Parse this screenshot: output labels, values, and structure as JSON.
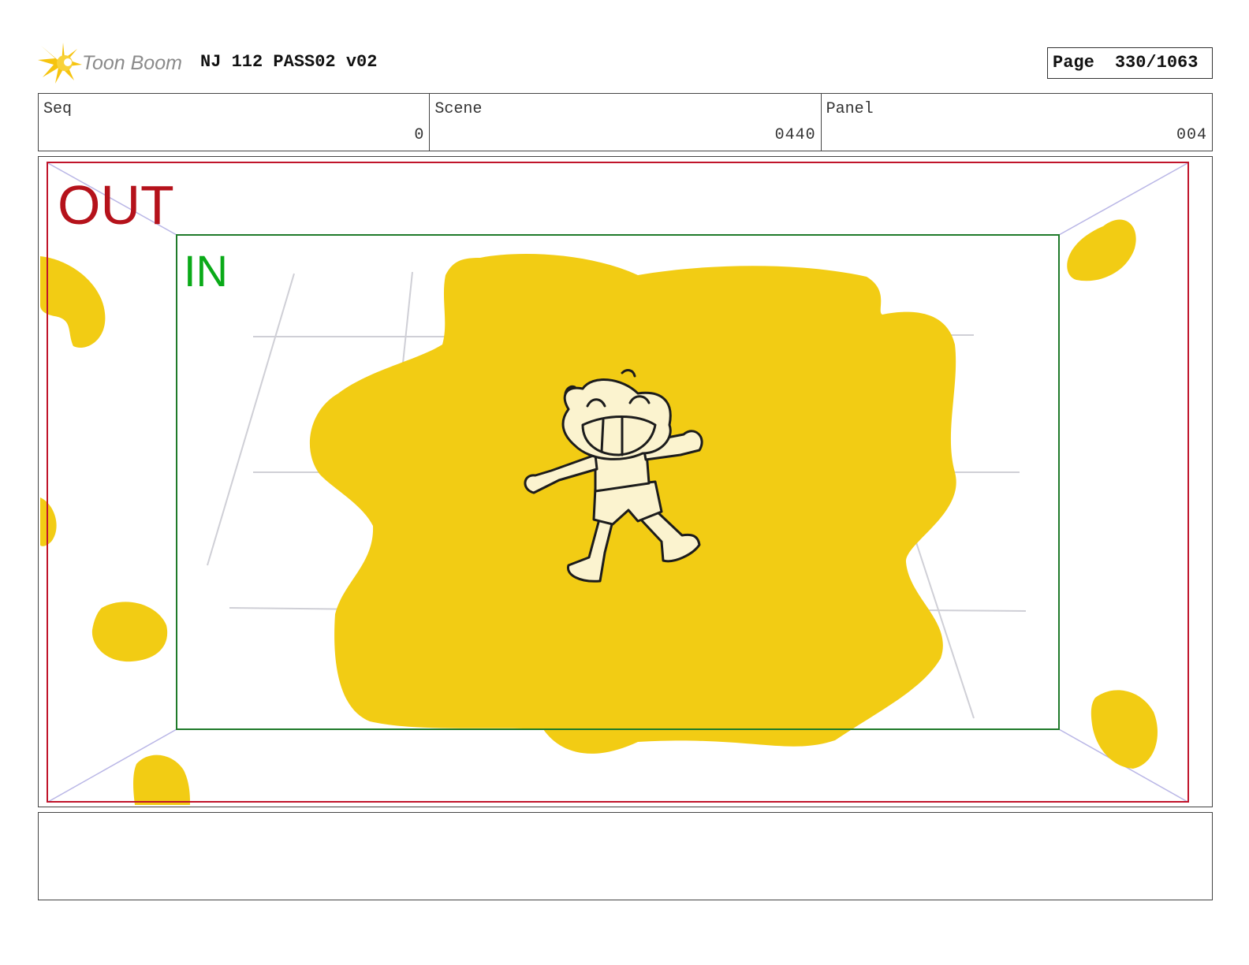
{
  "header": {
    "logo_text": "Toon Boom",
    "title": "NJ 112 PASS02 v02",
    "page_label": "Page",
    "page_value": "330/1063"
  },
  "info": {
    "seq_label": "Seq",
    "seq_value": "0",
    "scene_label": "Scene",
    "scene_value": "0440",
    "panel_label": "Panel",
    "panel_value": "004"
  },
  "panel": {
    "out_label": "OUT",
    "in_label": "IN",
    "colors": {
      "out_frame": "#c0142a",
      "in_frame": "#1f7a2a",
      "paint": "#f2cc14",
      "skin": "#fbf3cf"
    }
  },
  "notes": {
    "text": ""
  },
  "icons": [
    "toon-boom-logo-icon"
  ]
}
